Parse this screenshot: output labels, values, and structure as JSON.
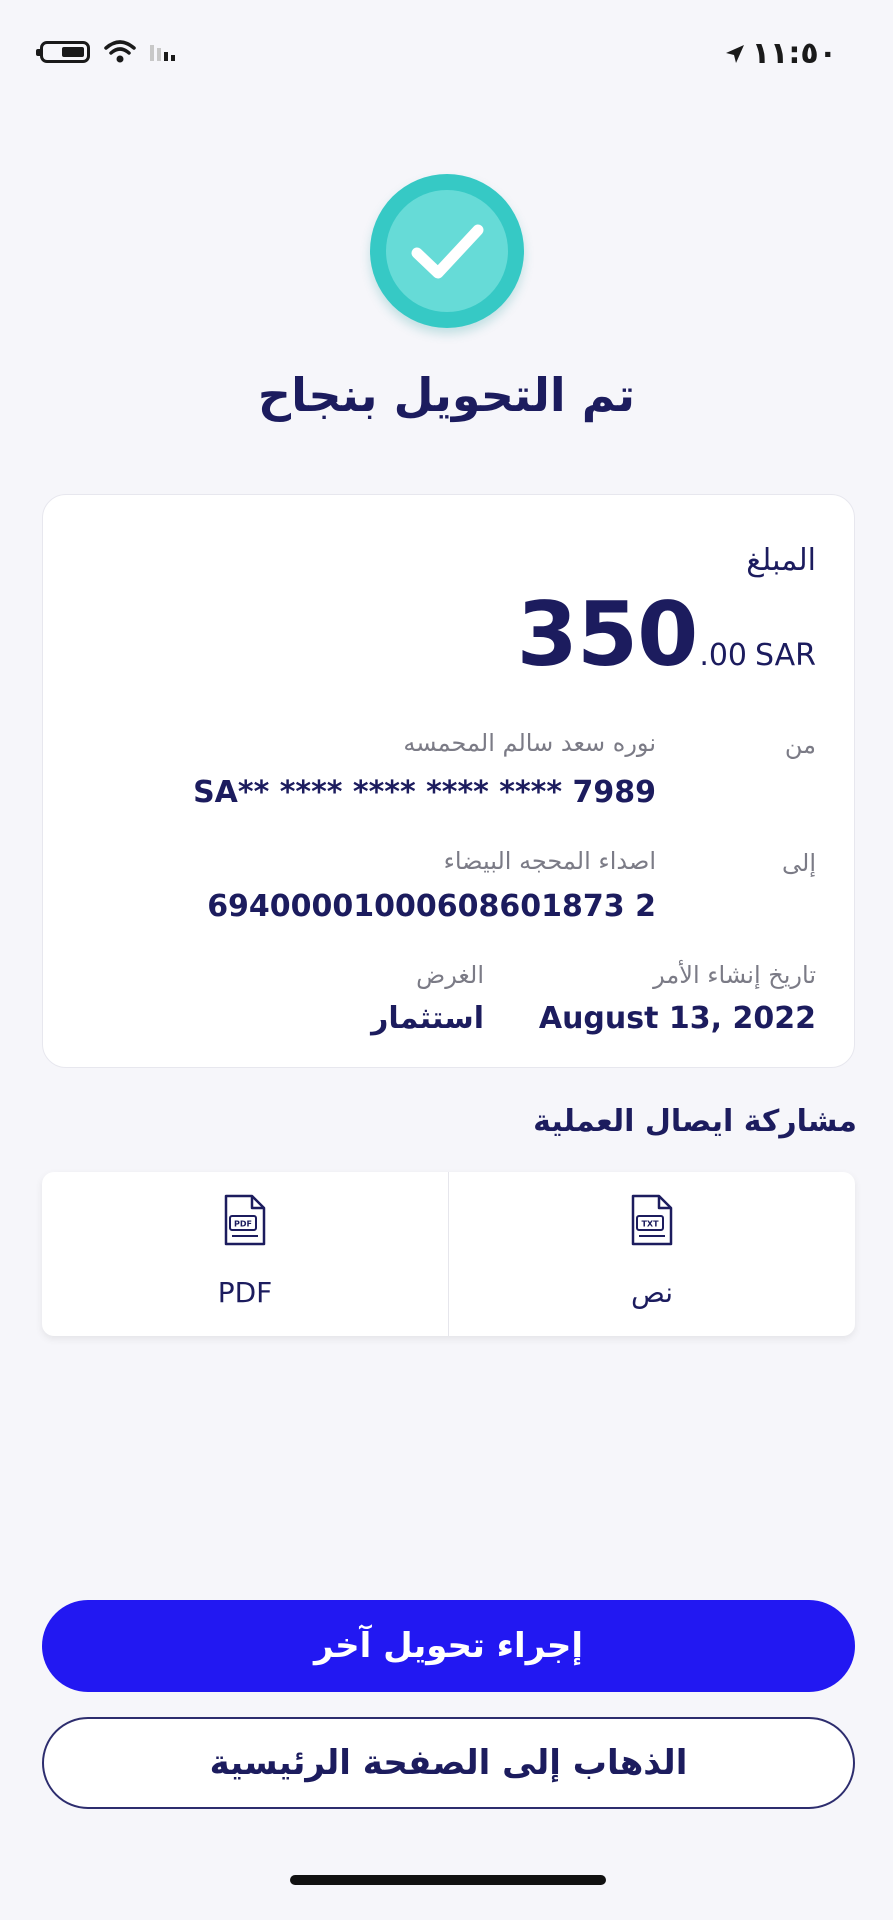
{
  "status_bar": {
    "time": "١١:٥٠",
    "icons": [
      "battery-icon",
      "wifi-icon",
      "cellular-signal-icon",
      "location-arrow-icon"
    ]
  },
  "header": {
    "icon": "checkmark-circle-icon",
    "title": "تم التحويل بنجاح"
  },
  "details": {
    "amount_label": "المبلغ",
    "amount_major": "350",
    "amount_minor": ".00",
    "currency": "SAR",
    "from_label": "من",
    "from_name": "نوره سعد سالم المحمسه",
    "from_account": "SA** **** **** **** **** 7989",
    "to_label": "إلى",
    "to_name": "اصداء المحجه البيضاء",
    "to_account": "69400001000608601873 2",
    "date_label": "تاريخ إنشاء الأمر",
    "date_value": "August 13, 2022",
    "purpose_label": "الغرض",
    "purpose_value": "استثمار"
  },
  "share": {
    "title": "مشاركة ايصال العملية",
    "options": [
      {
        "label": "PDF",
        "icon": "pdf-file-icon",
        "badge": "PDF"
      },
      {
        "label": "نص",
        "icon": "txt-file-icon",
        "badge": "TXT"
      }
    ]
  },
  "actions": {
    "primary_label": "إجراء تحويل آخر",
    "secondary_label": "الذهاب إلى الصفحة الرئيسية"
  },
  "colors": {
    "primary": "#2218f2",
    "text_dark": "#1c1c5e",
    "success": "#36c9c5",
    "background": "#f6f6fa"
  }
}
